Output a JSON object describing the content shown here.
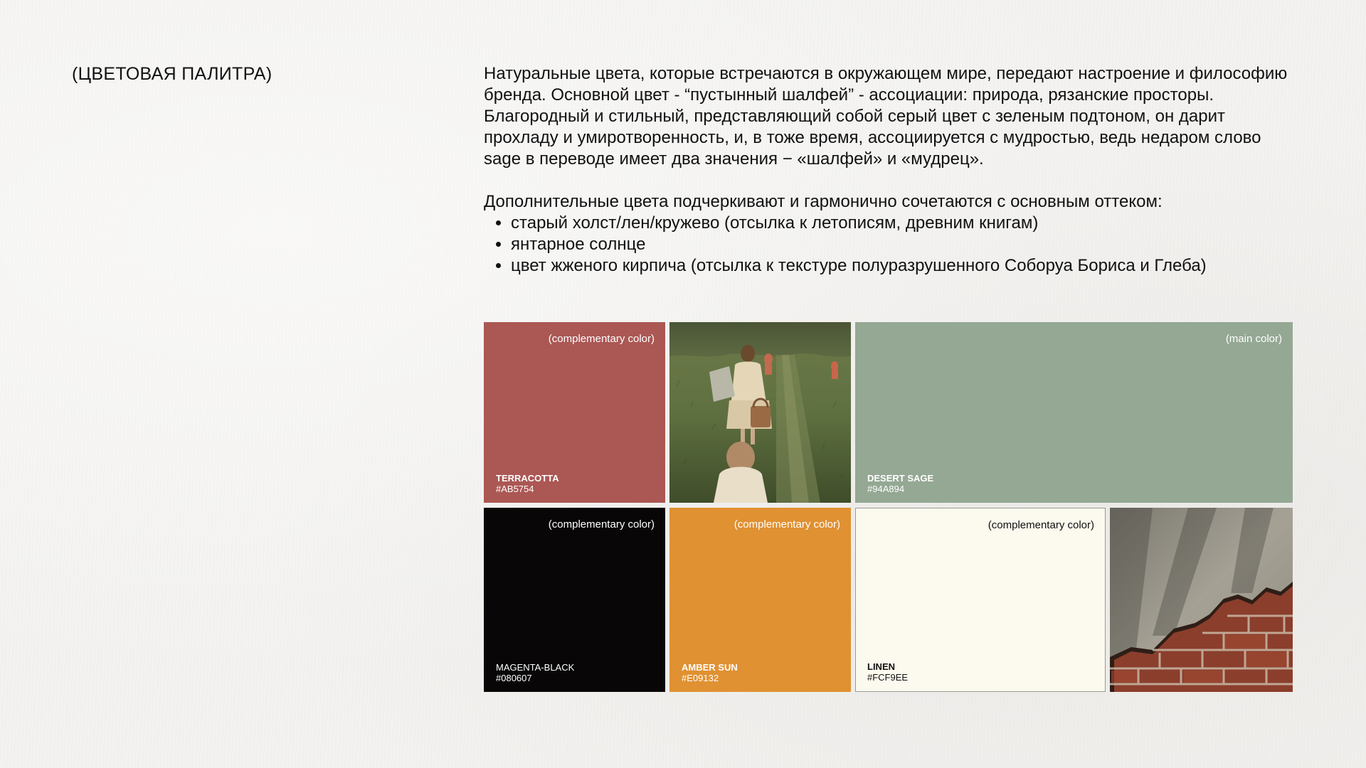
{
  "page": {
    "section_title": "(ЦВЕТОВАЯ ПАЛИТРА)",
    "intro_paragraph": "Натуральные цвета, которые встречаются в окружающем мире, передают настроение и философию бренда.  Основной цвет - “пустынный шалфей”  - ассоциации: природа, рязанские просторы. Благородный и стильный, представляющий собой серый цвет с зеленым подтоном, он дарит прохладу и умиротворенность, и, в тоже время, ассоциируется с мудростью, ведь недаром слово sage в переводе имеет два значения − «шалфей» и «мудрец».",
    "secondary_intro": "Дополнительные цвета подчеркивают и гармонично сочетаются с основным оттеком:",
    "bullets": [
      "старый холст/лен/кружево (отсылка к летописям, древним книгам)",
      "янтарное солнце",
      "цвет жженого кирпича (отсылка к текстуре полуразрушенного Соборуа Бориса и Глеба)"
    ]
  },
  "swatches": {
    "terracotta": {
      "tag": "(complementary color)",
      "name": "TERRACOTTA",
      "hex": "#AB5754",
      "color": "#AB5754"
    },
    "desert_sage": {
      "tag": "(main color)",
      "name": "DESERT SAGE",
      "hex": "#94A894",
      "color": "#94A894"
    },
    "magenta_black": {
      "tag": "(complementary color)",
      "name": "MAGENTA-BLACK",
      "hex": "#080607",
      "color": "#080607"
    },
    "amber_sun": {
      "tag": "(complementary color)",
      "name": "AMBER SUN",
      "hex": "#E09132",
      "color": "#E09132"
    },
    "linen": {
      "tag": "(complementary color)",
      "name": "LINEN",
      "hex": "#FCF9EE",
      "color": "#FCF9EE"
    }
  }
}
